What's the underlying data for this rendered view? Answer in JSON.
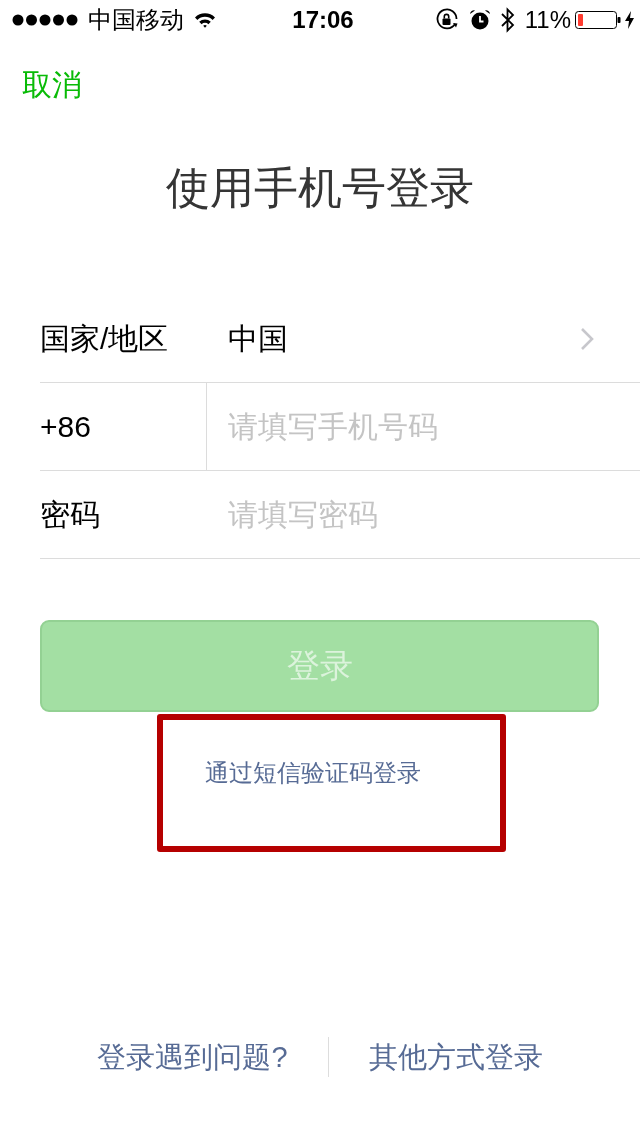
{
  "status_bar": {
    "carrier": "中国移动",
    "time": "17:06",
    "battery": "11%"
  },
  "nav": {
    "cancel": "取消"
  },
  "title": "使用手机号登录",
  "form": {
    "rows": [
      {
        "kind": "select",
        "label": "国家/地区",
        "value": "中国"
      },
      {
        "kind": "phone",
        "label": "+86",
        "placeholder": "请填写手机号码"
      },
      {
        "kind": "password",
        "label": "密码",
        "placeholder": "请填写密码"
      }
    ]
  },
  "login_button": {
    "label": "登录",
    "disabled": true
  },
  "sms_login": {
    "label": "通过短信验证码登录",
    "highlighted": true
  },
  "footer": {
    "links": [
      "登录遇到问题?",
      "其他方式登录"
    ]
  }
}
